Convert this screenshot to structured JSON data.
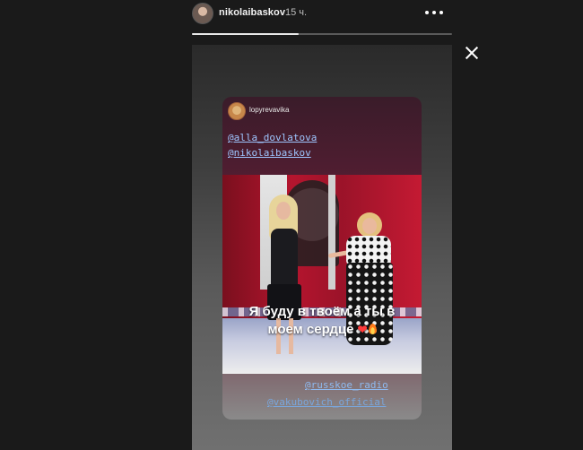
{
  "header": {
    "username": "nikolaibaskov",
    "time_ago": "15 ч."
  },
  "progress": {
    "fraction": 0.41
  },
  "story": {
    "repost": {
      "username": "lopyrevavika",
      "mentions_top": [
        "@alla_dovlatova",
        "@nikolaibaskov"
      ],
      "caption_line1": "Я буду  в твоём  а ты в",
      "caption_line2": "моем сердце",
      "mentions_bottom": [
        "@russkoe_radio",
        "@vakubovich_official"
      ]
    }
  },
  "colors": {
    "background": "#1a1a1a",
    "mention": "#9ec6ff",
    "heart": "#ff3b3b"
  },
  "icons": [
    "more-icon",
    "close-icon",
    "heart-icon",
    "fire-icon"
  ]
}
